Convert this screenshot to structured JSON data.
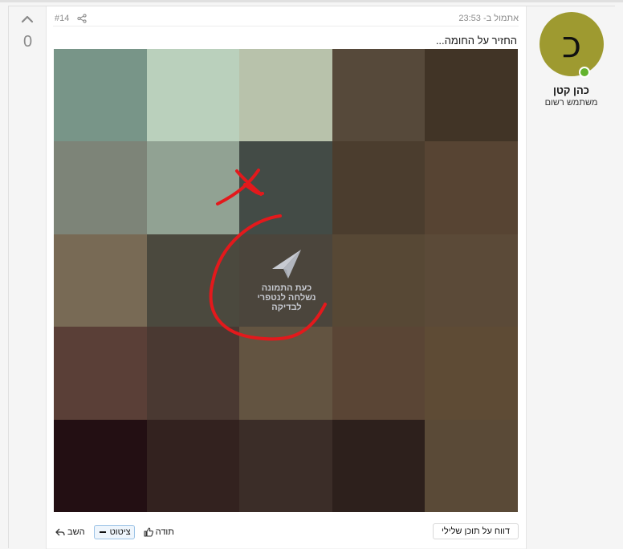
{
  "vote": {
    "count": "0",
    "icon": "chevron-up-icon"
  },
  "user": {
    "avatar_letter": "כ",
    "avatar_color": "#9e9a30",
    "online_color": "#63b32e",
    "name": "כהן קטן",
    "title": "משתמש רשום"
  },
  "post": {
    "date": "אתמול ב- 23:53",
    "number": "#14",
    "text": "החזיר על החומה...",
    "overlay_lines": [
      "כעת התמונה",
      "נשלחה לנטפרי",
      "לבדיקה"
    ],
    "tiles": [
      "#789588",
      "#bad0bc",
      "#b8c2ab",
      "#56493a",
      "#413426",
      "#7d8478",
      "#91a293",
      "#434b46",
      "#4b3d2e",
      "#574433",
      "#786a55",
      "#4b493e",
      "#4b453c",
      "#574835",
      "#5b4a38",
      "#5a3f37",
      "#4a3932",
      "#635441",
      "#5a4535",
      "#5e4b35",
      "#230f13",
      "#33221f",
      "#3b2d28",
      "#2d201c",
      "#5a4a37"
    ]
  },
  "footer": {
    "report_label": "דווח על תוכן שלילי",
    "like_label": "תודה",
    "quote_label": "ציטוט",
    "reply_label": "השב"
  }
}
